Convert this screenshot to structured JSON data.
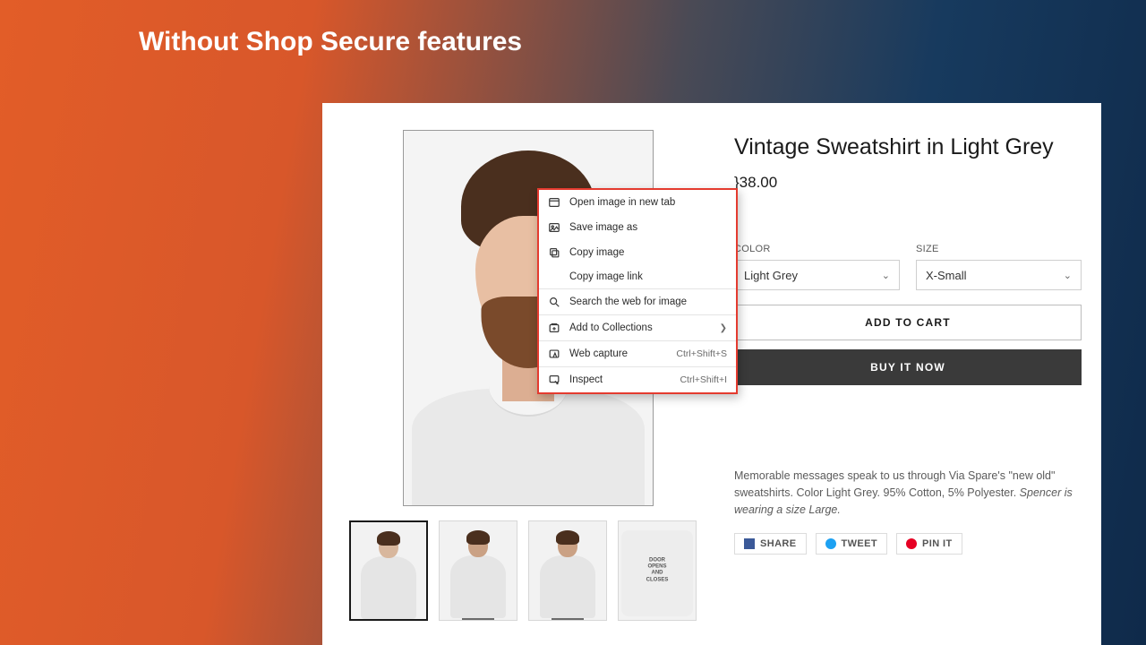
{
  "headline": "Without Shop Secure features",
  "product": {
    "title": "Vintage Sweatshirt in Light Grey",
    "price": "$38.00",
    "price_partial": "}38.00",
    "color_label": "COLOR",
    "size_label": "SIZE",
    "color_value": "Light Grey",
    "size_value": "X-Small",
    "add_to_cart": "ADD TO CART",
    "buy_now": "BUY IT NOW",
    "desc_plain": "Memorable messages speak to us through Via Spare's \"new old\" sweatshirts. Color Light Grey. 95% Cotton, 5% Polyester. ",
    "desc_em": "Spencer is wearing a size Large."
  },
  "social": {
    "share": "SHARE",
    "tweet": "TWEET",
    "pin": "PIN IT"
  },
  "thumb4_text": "DOOR\nOPENS\nAND\nCLOSES",
  "ctx": {
    "open_tab": "Open image in new tab",
    "save_as": "Save image as",
    "copy_img": "Copy image",
    "copy_link": "Copy image link",
    "search": "Search the web for image",
    "add_coll": "Add to Collections",
    "web_capture": "Web capture",
    "web_capture_accel": "Ctrl+Shift+S",
    "inspect": "Inspect",
    "inspect_accel": "Ctrl+Shift+I"
  }
}
